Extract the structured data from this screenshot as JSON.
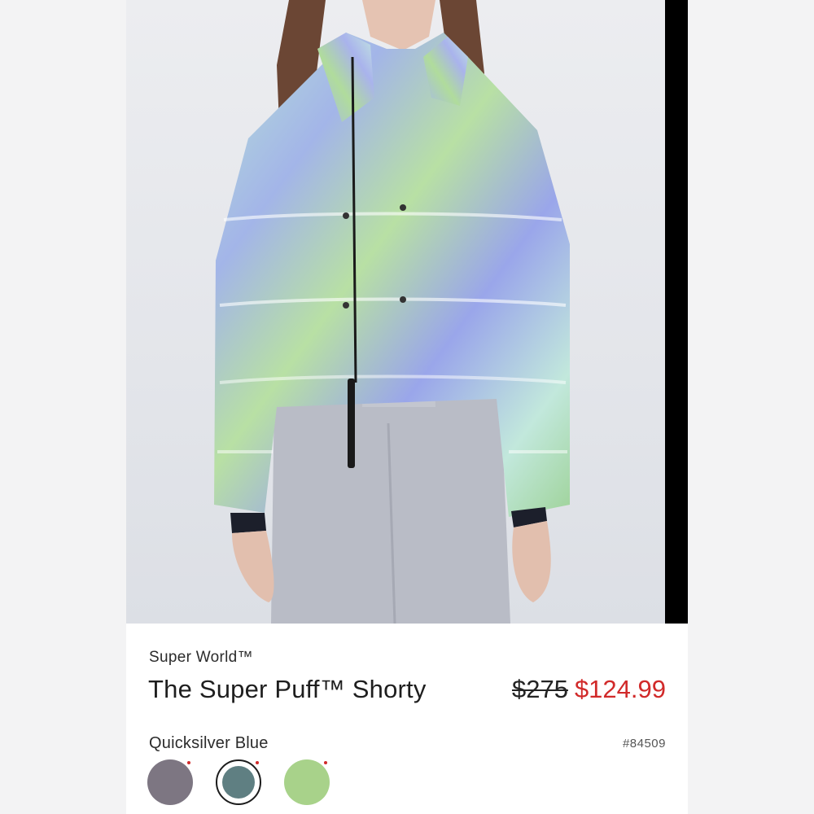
{
  "product": {
    "brand": "Super World™",
    "name": "The Super Puff™ Shorty",
    "price_original": "$275",
    "price_sale": "$124.99",
    "color_name": "Quicksilver Blue",
    "sku": "#84509"
  },
  "swatches": [
    {
      "color": "#7d7682",
      "selected": false
    },
    {
      "color": "#5f7f82",
      "selected": true
    },
    {
      "color": "#a8d28a",
      "selected": false
    }
  ],
  "colors": {
    "sale": "#d12a2a",
    "text": "#1e1e1e"
  }
}
